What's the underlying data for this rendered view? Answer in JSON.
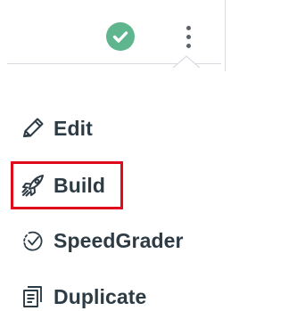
{
  "colors": {
    "success_green": "#5fb68e",
    "text": "#2d3b45",
    "icon_gray": "#5a6269",
    "divider": "#d7dbdf",
    "highlight_red": "#e00a1c"
  },
  "topbar": {
    "status_icon": "check-circle-icon",
    "more_icon": "kebab-menu-icon"
  },
  "menu": {
    "items": [
      {
        "label": "Edit",
        "icon": "pencil-icon"
      },
      {
        "label": "Build",
        "icon": "rocket-icon"
      },
      {
        "label": "SpeedGrader",
        "icon": "speedgrader-icon"
      },
      {
        "label": "Duplicate",
        "icon": "duplicate-icon"
      }
    ]
  }
}
